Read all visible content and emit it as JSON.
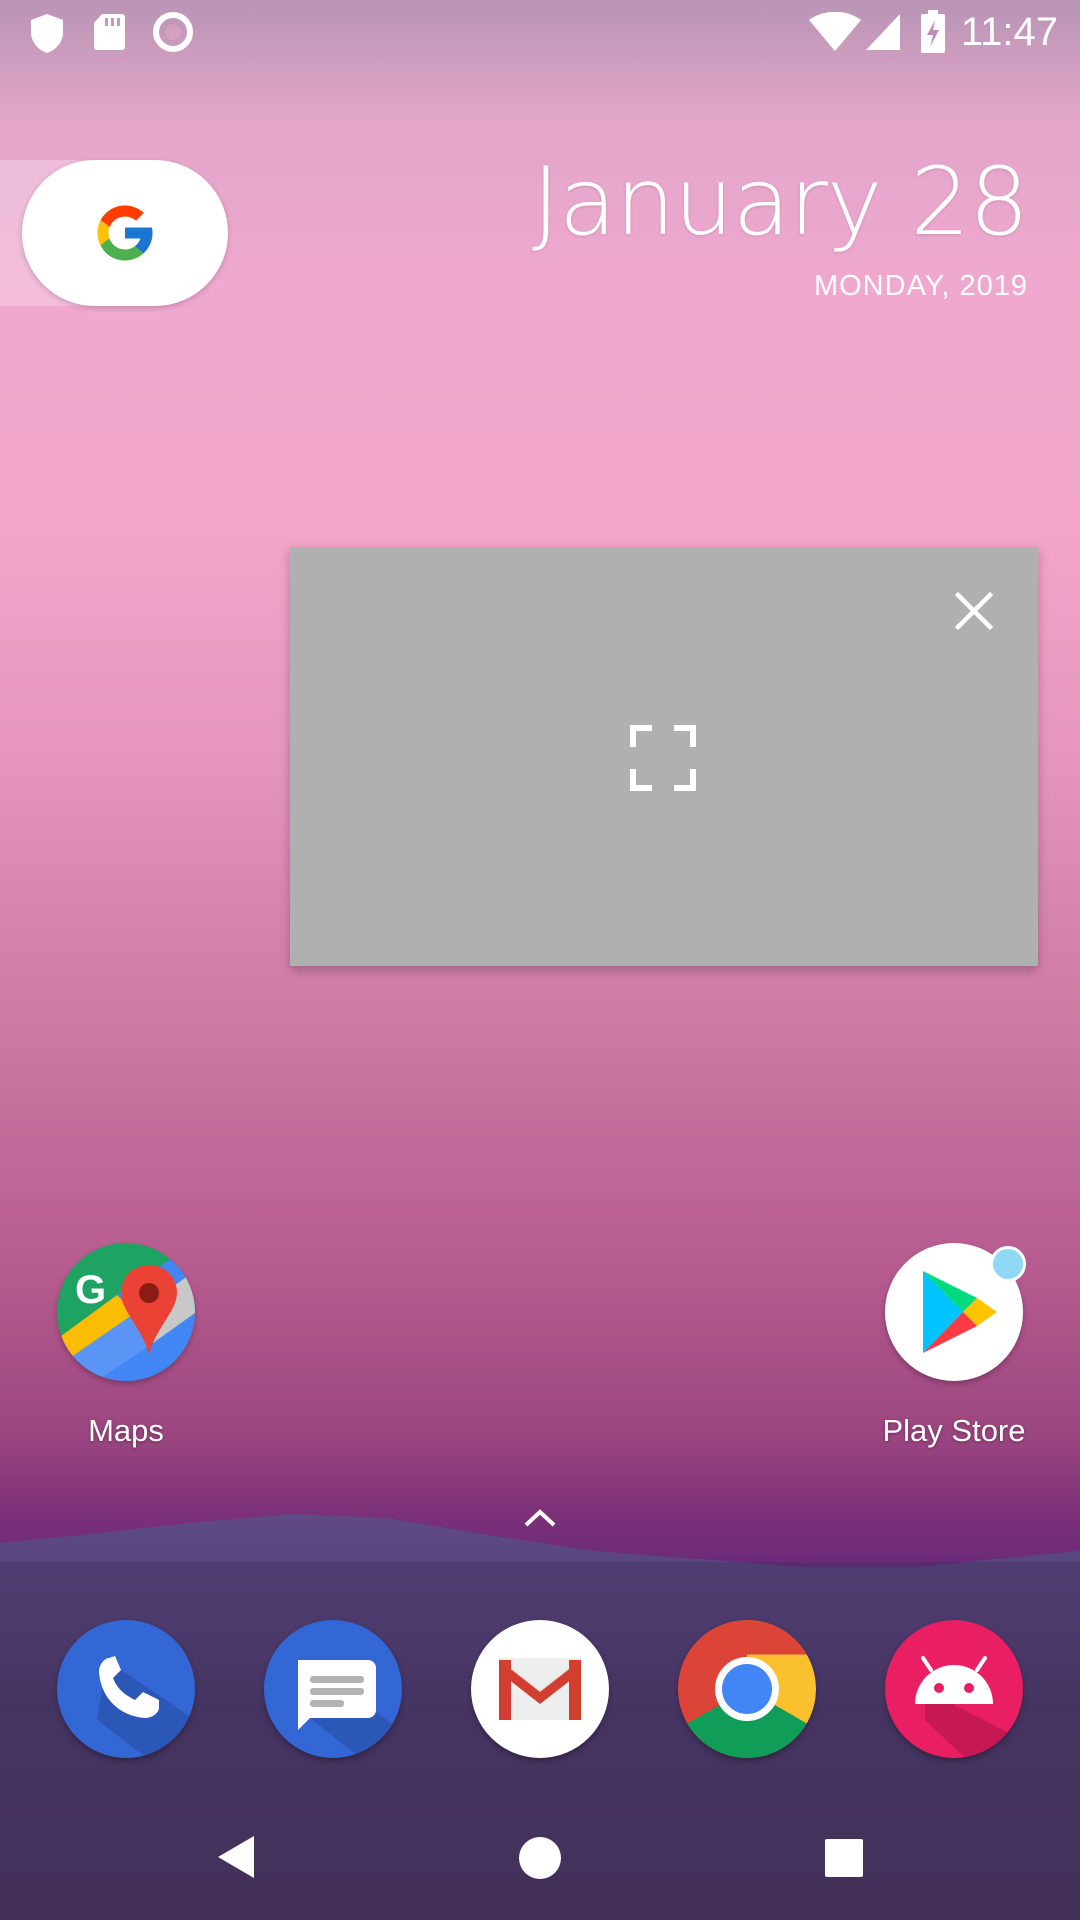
{
  "status_bar": {
    "time": "11:47",
    "icons": [
      "shield-icon",
      "sd-card-icon",
      "record-icon",
      "wifi-icon",
      "cell-signal-icon",
      "battery-charging-icon"
    ]
  },
  "search_widget": {
    "icon": "google-g-icon"
  },
  "date_widget": {
    "date": "January 28",
    "weekday_year": "MONDAY, 2019"
  },
  "pip_window": {
    "close_icon": "close-icon",
    "fullscreen_icon": "fullscreen-icon",
    "background": "#b0b0b0"
  },
  "home_apps": [
    {
      "label": "Maps",
      "icon": "maps-icon"
    },
    {
      "label": "Play Store",
      "icon": "play-store-icon",
      "has_notification": true
    }
  ],
  "app_drawer": {
    "icon": "chevron-up-icon"
  },
  "dock": [
    {
      "icon": "phone-icon",
      "color": "#3367d6"
    },
    {
      "icon": "messages-icon",
      "color": "#3367d6"
    },
    {
      "icon": "gmail-icon",
      "color": "#ffffff"
    },
    {
      "icon": "chrome-icon",
      "color": "#db4437"
    },
    {
      "icon": "android-icon",
      "color": "#e91e63"
    }
  ],
  "nav_bar": {
    "icons": [
      "back-icon",
      "home-icon",
      "recents-icon"
    ]
  }
}
